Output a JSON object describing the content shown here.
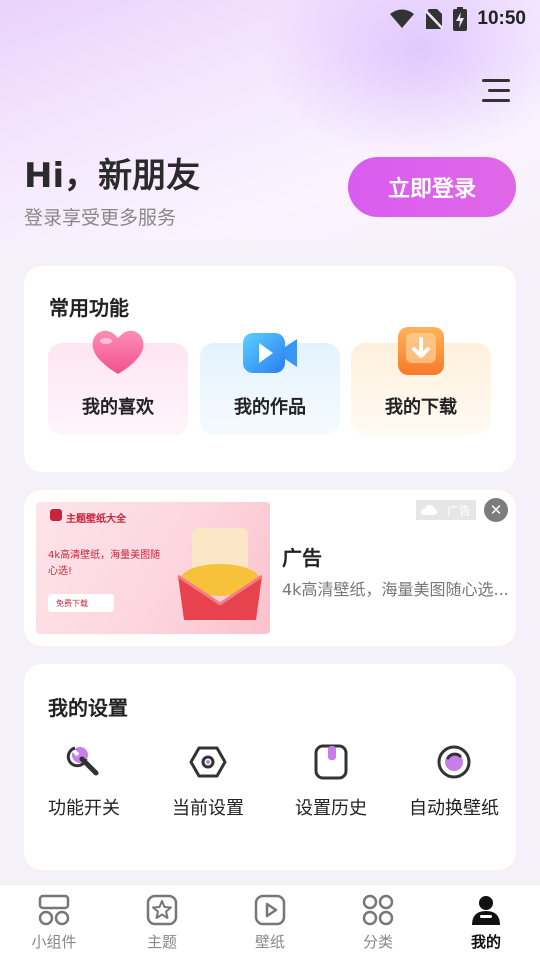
{
  "status_bar": {
    "time": "10:50",
    "icons": [
      "wifi-icon",
      "no-sim-icon",
      "battery-charging-icon"
    ]
  },
  "header": {
    "menu_icon": "menu-icon",
    "greeting": "Hi，新朋友",
    "subtitle": "登录享受更多服务",
    "login_label": "立即登录"
  },
  "common_functions": {
    "title": "常用功能",
    "items": [
      {
        "label": "我的喜欢",
        "icon": "heart-icon"
      },
      {
        "label": "我的作品",
        "icon": "video-camera-icon"
      },
      {
        "label": "我的下载",
        "icon": "download-icon"
      }
    ]
  },
  "ad": {
    "badge": "广告",
    "close_icon": "close-icon",
    "title": "广告",
    "description": "4k高清壁纸，海量美图随心选...",
    "image": {
      "brand": "主题壁纸大全",
      "text": "4k高清壁纸，海量美图随心选!",
      "button": "免费下载"
    }
  },
  "my_settings": {
    "title": "我的设置",
    "items": [
      {
        "label": "功能开关",
        "icon": "wrench-icon"
      },
      {
        "label": "当前设置",
        "icon": "hexagon-nut-icon"
      },
      {
        "label": "设置历史",
        "icon": "history-card-icon"
      },
      {
        "label": "自动换壁纸",
        "icon": "auto-wallpaper-icon"
      }
    ]
  },
  "tabs": [
    {
      "label": "小组件",
      "icon": "widgets-icon",
      "active": false
    },
    {
      "label": "主题",
      "icon": "theme-icon",
      "active": false
    },
    {
      "label": "壁纸",
      "icon": "wallpaper-play-icon",
      "active": false
    },
    {
      "label": "分类",
      "icon": "category-icon",
      "active": false
    },
    {
      "label": "我的",
      "icon": "profile-icon",
      "active": true
    }
  ],
  "colors": {
    "accent": "#dd62ee",
    "background": "#f4f2f8"
  }
}
